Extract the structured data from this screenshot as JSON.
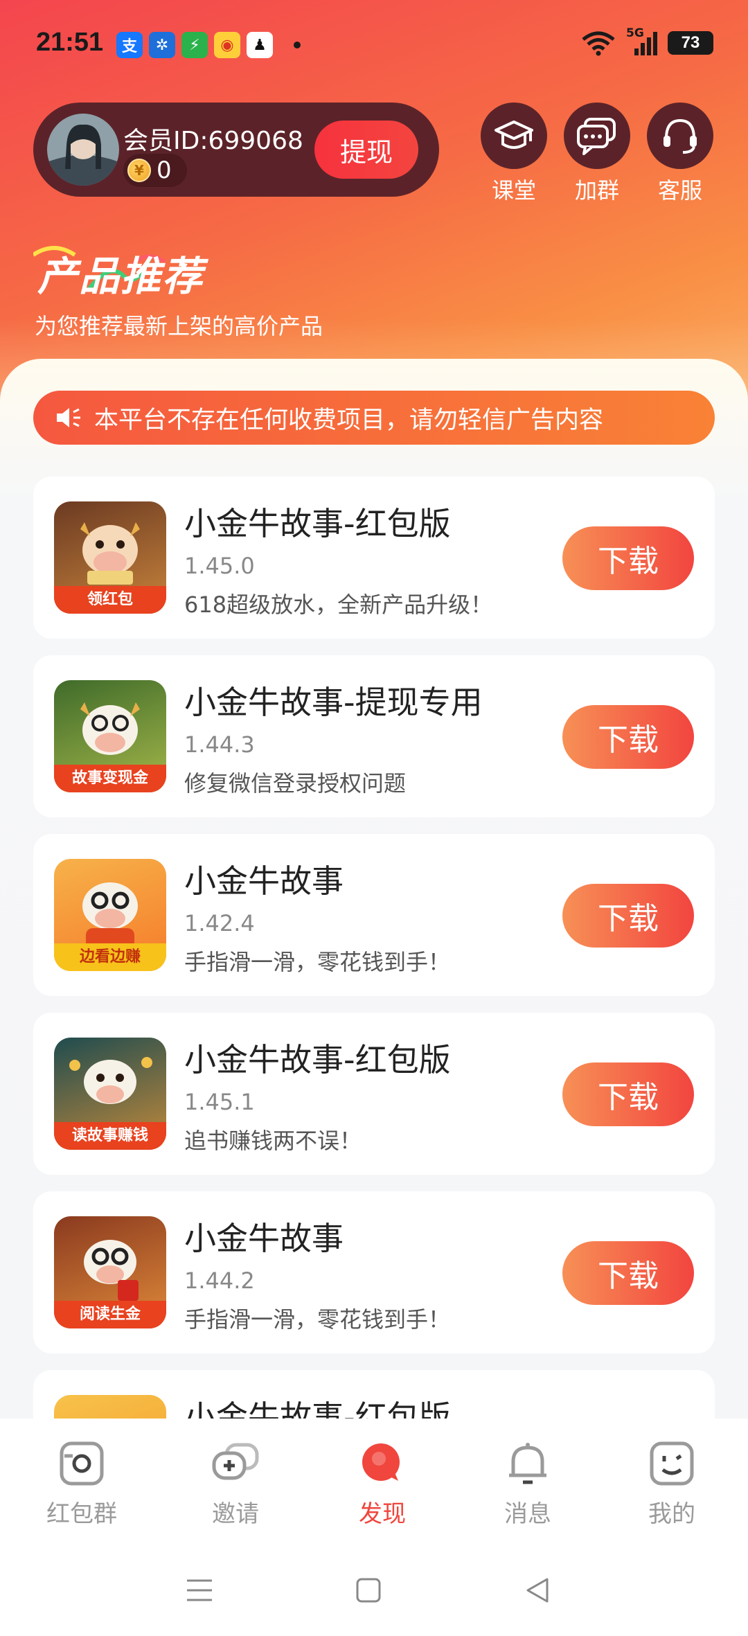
{
  "status": {
    "time": "21:51",
    "battery": "73",
    "network": "5G"
  },
  "header": {
    "member_id": "会员ID:699068",
    "coins": "0",
    "withdraw_label": "提现",
    "quick_actions": [
      {
        "label": "课堂",
        "icon": "graduation-cap-icon"
      },
      {
        "label": "加群",
        "icon": "chat-bubble-icon"
      },
      {
        "label": "客服",
        "icon": "headset-icon"
      }
    ],
    "section_title": "产品推荐",
    "section_subtitle": "为您推荐最新上架的高价产品"
  },
  "notice": {
    "text": "本平台不存在任何收费项目，请勿轻信广告内容"
  },
  "apps": [
    {
      "name": "小金牛故事-红包版",
      "version": "1.45.0",
      "desc": "618超级放水，全新产品升级！",
      "tag": "领红包",
      "button": "下载"
    },
    {
      "name": "小金牛故事-提现专用",
      "version": "1.44.3",
      "desc": "修复微信登录授权问题",
      "tag": "故事变现金",
      "button": "下载"
    },
    {
      "name": "小金牛故事",
      "version": "1.42.4",
      "desc": "手指滑一滑，零花钱到手！",
      "tag": "边看边赚",
      "button": "下载"
    },
    {
      "name": "小金牛故事-红包版",
      "version": "1.45.1",
      "desc": "追书赚钱两不误！",
      "tag": "读故事赚钱",
      "button": "下载"
    },
    {
      "name": "小金牛故事",
      "version": "1.44.2",
      "desc": "手指滑一滑，零花钱到手！",
      "tag": "阅读生金",
      "button": "下载"
    },
    {
      "name": "小金牛故事-红包版",
      "version": "",
      "desc": "",
      "tag": "",
      "button": ""
    }
  ],
  "tabs": [
    {
      "label": "红包群",
      "icon": "camera-square-icon"
    },
    {
      "label": "邀请",
      "icon": "chat-plus-icon"
    },
    {
      "label": "发现",
      "icon": "discover-icon"
    },
    {
      "label": "消息",
      "icon": "bell-icon"
    },
    {
      "label": "我的",
      "icon": "smile-face-icon"
    }
  ],
  "colors": {
    "accent": "#f0463d",
    "hero_top": "#f4454e",
    "hero_bottom": "#fbb068",
    "pill_bg": "#5b2329"
  }
}
